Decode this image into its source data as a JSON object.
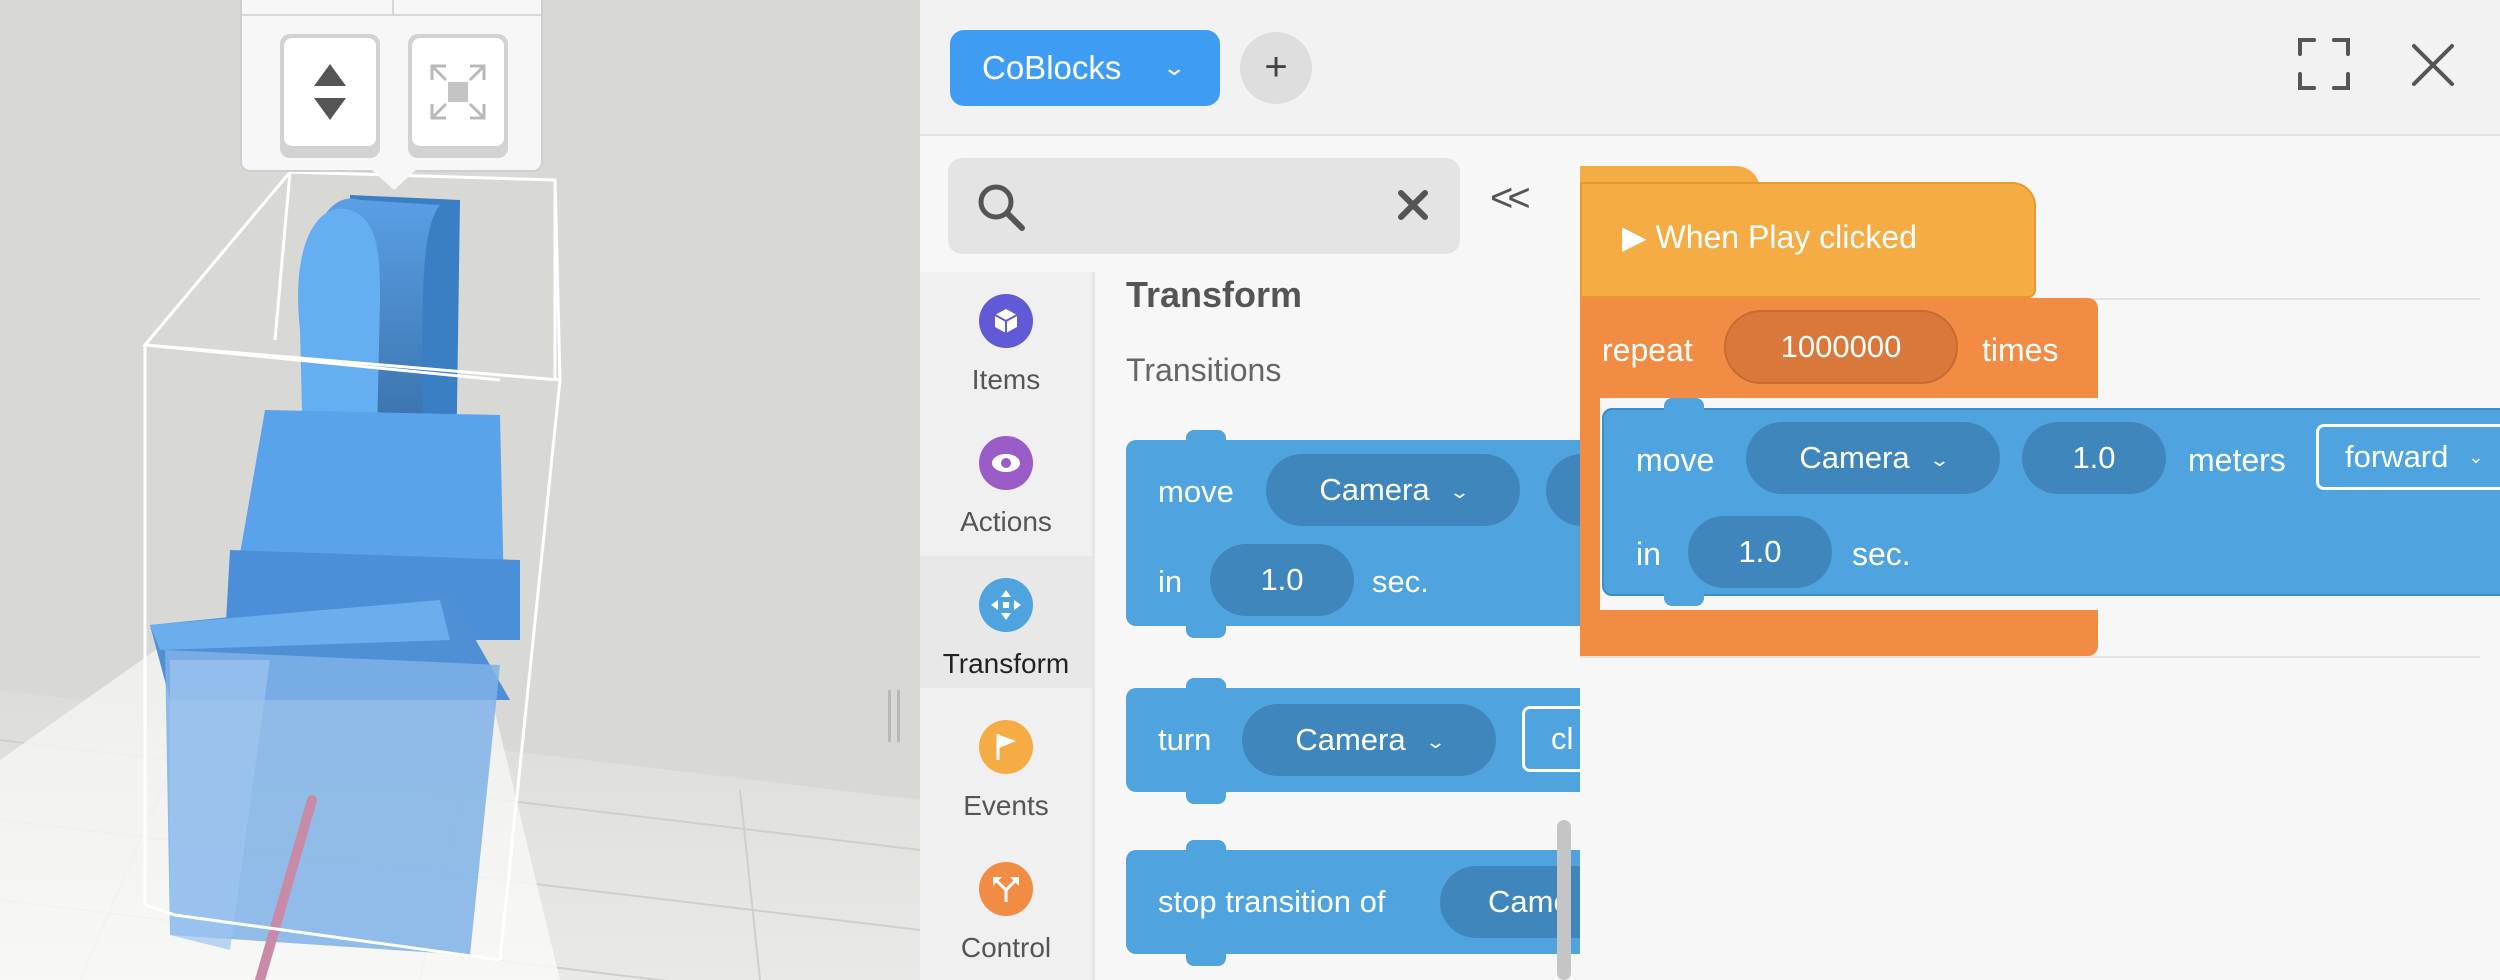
{
  "header": {
    "project_label": "CoBlocks",
    "add_label": "+"
  },
  "search": {
    "placeholder": "",
    "collapse_label": "<<"
  },
  "categories": [
    {
      "label": "Items",
      "color": "#6259d6",
      "icon": "cube-icon"
    },
    {
      "label": "Actions",
      "color": "#9a5cc7",
      "icon": "eye-icon"
    },
    {
      "label": "Transform",
      "color": "#4fa3de",
      "icon": "move-arrows-icon",
      "active": true
    },
    {
      "label": "Events",
      "color": "#f5ac45",
      "icon": "flag-icon"
    },
    {
      "label": "Control",
      "color": "#f28c45",
      "icon": "fork-arrows-icon"
    }
  ],
  "palette": {
    "section_title": "Transform",
    "subsection_title": "Transitions",
    "move_block": {
      "verb": "move",
      "target": "Camera",
      "in_label": "in",
      "duration": "1.0",
      "unit": "sec."
    },
    "turn_block": {
      "verb": "turn",
      "target": "Camera",
      "direction": "cl"
    },
    "stop_block": {
      "verb": "stop transition of",
      "target": "Came"
    }
  },
  "script": {
    "hat_label": "When Play clicked",
    "repeat_label": "repeat",
    "repeat_count": "1000000",
    "times_label": "times",
    "move": {
      "verb": "move",
      "target": "Camera",
      "distance": "1.0",
      "unit": "meters",
      "direction": "forward",
      "in_label": "in",
      "duration": "1.0",
      "time_unit": "sec."
    }
  },
  "colors": {
    "accent": "#3f9cf3",
    "transform_block": "#4fa3de",
    "event_block": "#f5ac45",
    "control_block": "#f28c45",
    "selection_box": "#ffffff",
    "model": "#4a90e2"
  }
}
